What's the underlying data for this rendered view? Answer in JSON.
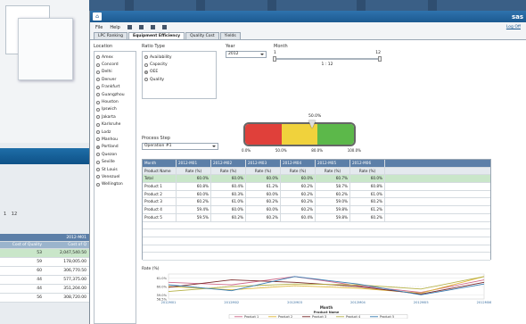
{
  "background": {
    "slider": {
      "min": "1",
      "max": "12"
    },
    "table": {
      "header": "2012-M01",
      "col1": "Cost of Quality",
      "col2": "Cost of Q",
      "rows": [
        {
          "a": "53",
          "b": "2,047,540.50"
        },
        {
          "a": "59",
          "b": "178,005.00"
        },
        {
          "a": "60",
          "b": "306,770.50"
        },
        {
          "a": "44",
          "b": "577,375.00"
        },
        {
          "a": "44",
          "b": "351,204.00"
        },
        {
          "a": "56",
          "b": "308,720.00"
        }
      ]
    }
  },
  "app": {
    "brand": "sas",
    "menu": {
      "file": "File",
      "help": "Help",
      "logoff": "Log Off"
    },
    "tabs": [
      {
        "label": "LPC Ranking",
        "active": false
      },
      {
        "label": "Equipment Efficiency",
        "active": true
      },
      {
        "label": "Quality Cost",
        "active": false
      },
      {
        "label": "Yields",
        "active": false
      }
    ],
    "location": {
      "label": "Location",
      "options": [
        {
          "label": "Amex",
          "checked": false
        },
        {
          "label": "Concord",
          "checked": false
        },
        {
          "label": "Delhi",
          "checked": false
        },
        {
          "label": "Denver",
          "checked": false
        },
        {
          "label": "Frankfurt",
          "checked": false
        },
        {
          "label": "Guangzhou",
          "checked": false
        },
        {
          "label": "Houston",
          "checked": false
        },
        {
          "label": "Ipswich",
          "checked": false
        },
        {
          "label": "Jakarta",
          "checked": false
        },
        {
          "label": "Karlsruhe",
          "checked": false
        },
        {
          "label": "Lodz",
          "checked": false
        },
        {
          "label": "Manhou",
          "checked": false
        },
        {
          "label": "Portland",
          "checked": true
        },
        {
          "label": "Quezon",
          "checked": false
        },
        {
          "label": "Seville",
          "checked": false
        },
        {
          "label": "St Louis",
          "checked": false
        },
        {
          "label": "Venezuel",
          "checked": false
        },
        {
          "label": "Wellington",
          "checked": false
        }
      ]
    },
    "ratio_type": {
      "label": "Ratio Type",
      "options": [
        {
          "label": "Availability",
          "checked": false
        },
        {
          "label": "Capacity",
          "checked": false
        },
        {
          "label": "OEE",
          "checked": true
        },
        {
          "label": "Quality",
          "checked": false
        }
      ]
    },
    "year": {
      "label": "Year",
      "value": "2012"
    },
    "month": {
      "label": "Month",
      "min": "1",
      "max": "12",
      "range_text": "1 : 12"
    },
    "process_step": {
      "label": "Process Step",
      "value": "Operation #1"
    },
    "gauge": {
      "value": "50.0%",
      "labels": [
        "0.0%",
        "50.0%",
        "80.0%",
        "100.0%"
      ],
      "colors": [
        "#e0403a",
        "#f0d23c",
        "#5cb84a"
      ]
    },
    "grid": {
      "month_label": "Month",
      "months": [
        "2012-M01",
        "2012-M02",
        "2012-M03",
        "2012-M04",
        "2012-M05",
        "2012-M06"
      ],
      "product_header": "Product Name",
      "rate_label": "Rate (%)",
      "rows": [
        {
          "name": "Total",
          "values": [
            "60.0%",
            "60.0%",
            "60.0%",
            "60.0%",
            "60.7%",
            "60.0%"
          ],
          "total": true
        },
        {
          "name": "Product 1",
          "values": [
            "60.8%",
            "60.4%",
            "61.2%",
            "60.2%",
            "58.7%",
            "60.8%"
          ]
        },
        {
          "name": "Product 2",
          "values": [
            "60.0%",
            "60.3%",
            "60.0%",
            "60.2%",
            "60.2%",
            "61.0%"
          ]
        },
        {
          "name": "Product 3",
          "values": [
            "60.2%",
            "61.0%",
            "60.2%",
            "60.2%",
            "59.0%",
            "60.2%"
          ]
        },
        {
          "name": "Product 4",
          "values": [
            "59.4%",
            "60.0%",
            "60.0%",
            "60.2%",
            "59.8%",
            "61.2%"
          ]
        },
        {
          "name": "Product 5",
          "values": [
            "59.5%",
            "60.2%",
            "60.2%",
            "60.4%",
            "59.8%",
            "60.2%"
          ]
        }
      ]
    },
    "chart": {
      "title": "Rate (%)",
      "xlabel": "Month",
      "legend_title": "Product Name"
    }
  },
  "chart_data": {
    "type": "line",
    "x": [
      "2012M01",
      "2012M02",
      "2012M03",
      "2012M04",
      "2012M05",
      "2012M06"
    ],
    "yticks": [
      "61.0%",
      "60.0%",
      "59.0%",
      "58.5%"
    ],
    "ylim": [
      58.5,
      61.5
    ],
    "series": [
      {
        "name": "Product 1",
        "values": [
          60.5,
          60.2,
          61.2,
          60.1,
          59.3,
          60.8
        ],
        "color": "#d06a8a"
      },
      {
        "name": "Product 2",
        "values": [
          60.0,
          59.6,
          60.1,
          59.8,
          59.2,
          61.2
        ],
        "color": "#e0b83a"
      },
      {
        "name": "Product 3",
        "values": [
          59.9,
          60.8,
          60.5,
          60.0,
          59.1,
          60.5
        ],
        "color": "#7a2a2a"
      },
      {
        "name": "Product 4",
        "values": [
          59.4,
          60.0,
          60.3,
          60.2,
          59.7,
          61.2
        ],
        "color": "#b7b34a"
      },
      {
        "name": "Product 5",
        "values": [
          60.2,
          59.5,
          61.2,
          60.3,
          59.0,
          60.3
        ],
        "color": "#3a7fb4"
      }
    ]
  }
}
